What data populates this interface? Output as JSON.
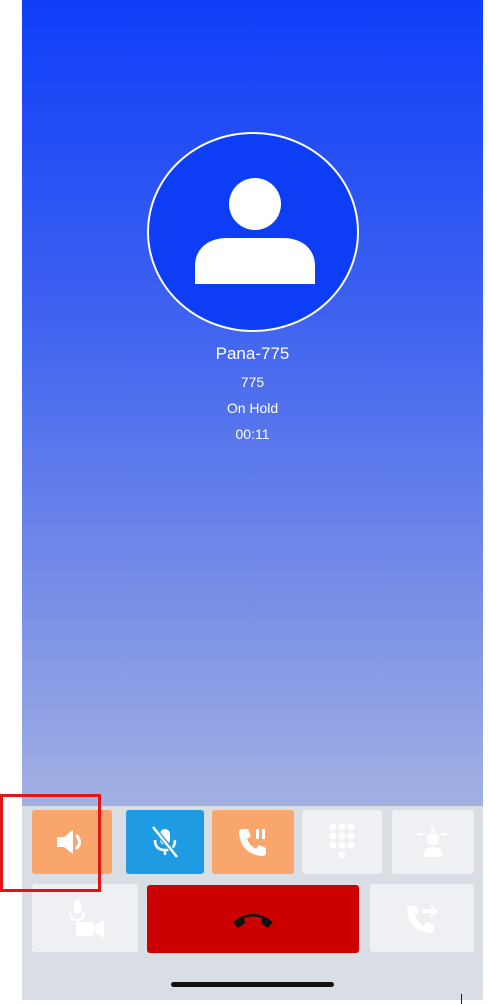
{
  "call": {
    "caller_name": "Pana-775",
    "caller_number": "775",
    "status": "On Hold",
    "duration": "00:11"
  },
  "controls": {
    "row1": [
      {
        "id": "speaker",
        "icon": "speaker-icon",
        "color": "#f8a66b",
        "active": true
      },
      {
        "id": "mute",
        "icon": "mic-muted-icon",
        "color": "#1e9be3",
        "active": true
      },
      {
        "id": "hold",
        "icon": "hold-call-icon",
        "color": "#f8a66b",
        "active": true
      },
      {
        "id": "keypad",
        "icon": "keypad-icon",
        "color": "#eef0f3",
        "active": false
      },
      {
        "id": "conference",
        "icon": "conference-icon",
        "color": "#eef0f3",
        "active": false
      }
    ],
    "row2": [
      {
        "id": "video",
        "icon": "video-call-icon",
        "color": "#eef0f3",
        "active": false
      },
      {
        "id": "end_call",
        "icon": "hang-up-icon",
        "color": "#cc0000",
        "active": true
      },
      {
        "id": "transfer",
        "icon": "call-transfer-icon",
        "color": "#eef0f3",
        "active": false
      }
    ]
  },
  "colors": {
    "gradient_top": "#0f3ef9",
    "gradient_bottom": "#c5cde3",
    "highlight": "#e31414"
  }
}
